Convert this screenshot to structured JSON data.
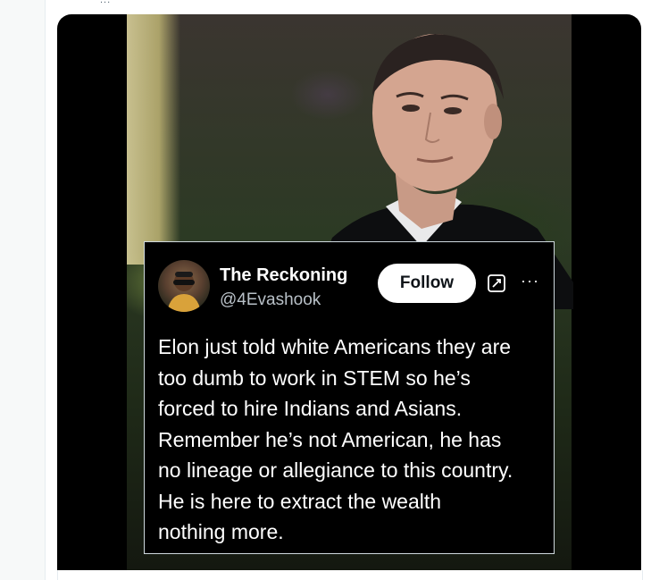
{
  "top_fragment": "...",
  "tweet": {
    "author_name": "The Reckoning",
    "author_handle": "@4Evashook",
    "follow_label": "Follow",
    "more_label": "···",
    "text_lines": [
      "Elon just told white Americans they are",
      "too dumb to work in STEM so he’s",
      "forced to hire Indians and Asians.",
      "Remember he’s not American, he has",
      "no lineage or allegiance to this country.",
      "He is here to extract the wealth",
      "nothing more."
    ]
  },
  "icons": {
    "grok": "grok-icon",
    "more": "more-icon"
  },
  "colors": {
    "tweet_bg": "#000000",
    "follow_bg": "#ffffff",
    "text": "#ffffff",
    "handle": "#b8c0c7"
  }
}
